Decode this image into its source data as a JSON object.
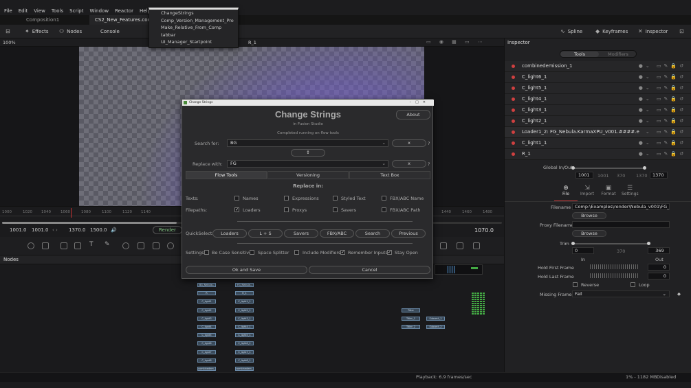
{
  "menubar": {
    "items": [
      "File",
      "Edit",
      "View",
      "Tools",
      "Script",
      "Window",
      "Reactor",
      "Help"
    ]
  },
  "tabs": {
    "comp1": "Composition1",
    "comp2": "CS2_New_Features.comp *"
  },
  "toolbar": {
    "effects": "Effects",
    "nodes": "Nodes",
    "console": "Console",
    "spline": "Spline",
    "keyframes": "Keyframes",
    "inspector": "Inspector"
  },
  "viewer": {
    "zoom": "100%",
    "name": "R_1"
  },
  "timeline": {
    "ticks": [
      "1000",
      "1020",
      "1040",
      "1060",
      "1080",
      "1100",
      "1120",
      "1140",
      "1440",
      "1460",
      "1480"
    ],
    "start": "1001.0",
    "render_start": "1001.0",
    "render_end": "1370.0",
    "end": "1500.0",
    "render_label": "Render",
    "current": "1070.0"
  },
  "nodes_panel": {
    "title": "Nodes",
    "col1": [
      "BG_Nebula..",
      "R",
      "C_light1",
      "C_light2",
      "C_light3",
      "C_light4",
      "C_light5",
      "C_light6",
      "C_light7",
      "C_light8",
      "combinedem.."
    ],
    "col2": [
      "FG_Nebula..",
      "R_1",
      "C_light1_1",
      "C_light2_1",
      "C_light3_1",
      "C_light4_1",
      "C_light5_1",
      "C_light6_1",
      "C_light7_1",
      "C_light8_1",
      "combinedem.."
    ],
    "col3": [
      "Titler",
      "Titler_1",
      "Titler_2"
    ],
    "col4": [
      "Subsect_1",
      "Subsect_2"
    ]
  },
  "status": {
    "playback": "Playback: 6.9 frames/sec",
    "memory": "1% - 1182 MB",
    "state": "Disabled"
  },
  "dropdown": {
    "items": [
      "ChangeStrings",
      "Comp_Version_Management_Pro",
      "Make_Relative_From_Comp",
      "tabbar",
      "UI_Manager_Startpoint"
    ]
  },
  "inspector": {
    "title": "Inspector",
    "tab_tools": "Tools",
    "tab_modifiers": "Modifiers",
    "tools": [
      "combinedemission_1",
      "C_light6_1",
      "C_light5_1",
      "C_light4_1",
      "C_light3_1",
      "C_light2_1",
      "Loader1_2: FG_Nebula.KarmaXPU_v001.####.e",
      "C_light1_1",
      "R_1"
    ],
    "global_label": "Global In/Out",
    "global_vals": {
      "a": "1001",
      "b": "1001",
      "c": "370",
      "d": "1370",
      "e": "1370"
    },
    "subtabs": [
      "File",
      "Import",
      "Format",
      "Settings"
    ],
    "filename_label": "Filename",
    "filename": "Comp:\\Examples\\render\\Nebula_v001\\FG_Nebu",
    "browse": "Browse",
    "proxy_label": "Proxy Filename",
    "trim_label": "Trim",
    "trim_in": "0",
    "trim_mid": "370",
    "trim_out": "369",
    "in_label": "In",
    "out_label": "Out",
    "hold_first": "Hold First Frame",
    "hold_first_val": "0",
    "hold_last": "Hold Last Frame",
    "hold_last_val": "0",
    "reverse": "Reverse",
    "loop": "Loop",
    "missing_label": "Missing Frames",
    "missing_val": "Fail"
  },
  "dialog": {
    "window_title": "Change Strings",
    "heading": "Change Strings",
    "subheading": "in Fusion Studio",
    "status": "Completed running on flow tools",
    "about": "About",
    "search_label": "Search for:",
    "search_value": "BG",
    "clear": "x",
    "help": "?",
    "swap": "↕",
    "replace_label": "Replace with:",
    "replace_value": "FG",
    "tabs": [
      "Flow Tools",
      "Versioning",
      "Text Box"
    ],
    "replace_in": "Replace in:",
    "texts_label": "Texts:",
    "texts": [
      "Names",
      "Expressions",
      "Styled Text",
      "FBX/ABC Name"
    ],
    "filepaths_label": "Filepaths:",
    "filepaths": [
      "Loaders",
      "Proxys",
      "Savers",
      "FBX/ABC Path"
    ],
    "quickselect_label": "QuickSelect:",
    "quickselect": [
      "Loaders",
      "L + S",
      "Savers",
      "FBX/ABC",
      "Search",
      "Previous"
    ],
    "settings_label": "Settings:",
    "settings": [
      "Be Case Sensitive",
      "Space Splitter",
      "Include Modifiers",
      "Remember Inputs",
      "Stay Open"
    ],
    "ok": "Ok and Save",
    "cancel": "Cancel"
  },
  "colors": {
    "accent_red": "#d04040",
    "accent_blue": "#5aa0e0",
    "dialog_bg": "#2a2a2c",
    "nebula": "#8a6ed8"
  }
}
